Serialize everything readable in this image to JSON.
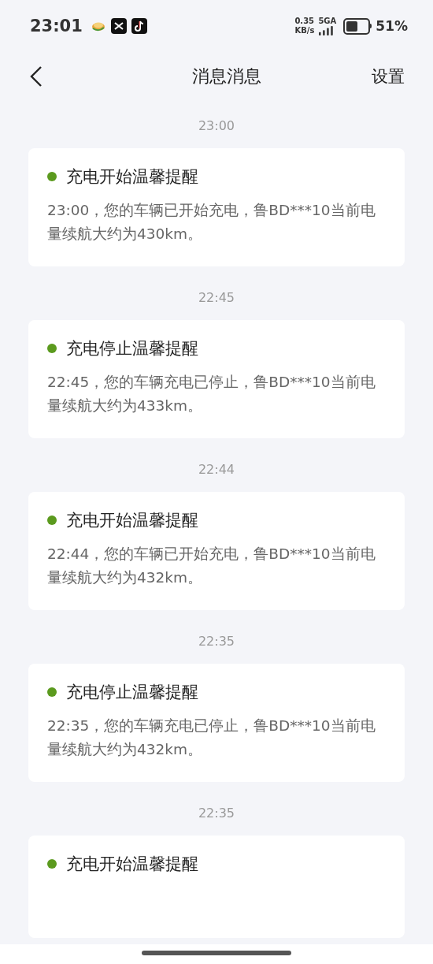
{
  "status_bar": {
    "time": "23:01",
    "speed": "0.35",
    "speed_unit": "KB/s",
    "network": "5GA",
    "battery": "51%"
  },
  "header": {
    "title": "消息消息",
    "action": "设置"
  },
  "messages": [
    {
      "time": "23:00",
      "title": "充电开始温馨提醒",
      "body": "23:00，您的车辆已开始充电，鲁BD***10当前电量续航大约为430km。",
      "unread": true
    },
    {
      "time": "22:45",
      "title": "充电停止温馨提醒",
      "body": "22:45，您的车辆充电已停止，鲁BD***10当前电量续航大约为433km。",
      "unread": true
    },
    {
      "time": "22:44",
      "title": "充电开始温馨提醒",
      "body": "22:44，您的车辆已开始充电，鲁BD***10当前电量续航大约为432km。",
      "unread": true
    },
    {
      "time": "22:35",
      "title": "充电停止温馨提醒",
      "body": "22:35，您的车辆充电已停止，鲁BD***10当前电量续航大约为432km。",
      "unread": true
    },
    {
      "time": "22:35",
      "title": "充电开始温馨提醒",
      "unread": true
    }
  ]
}
